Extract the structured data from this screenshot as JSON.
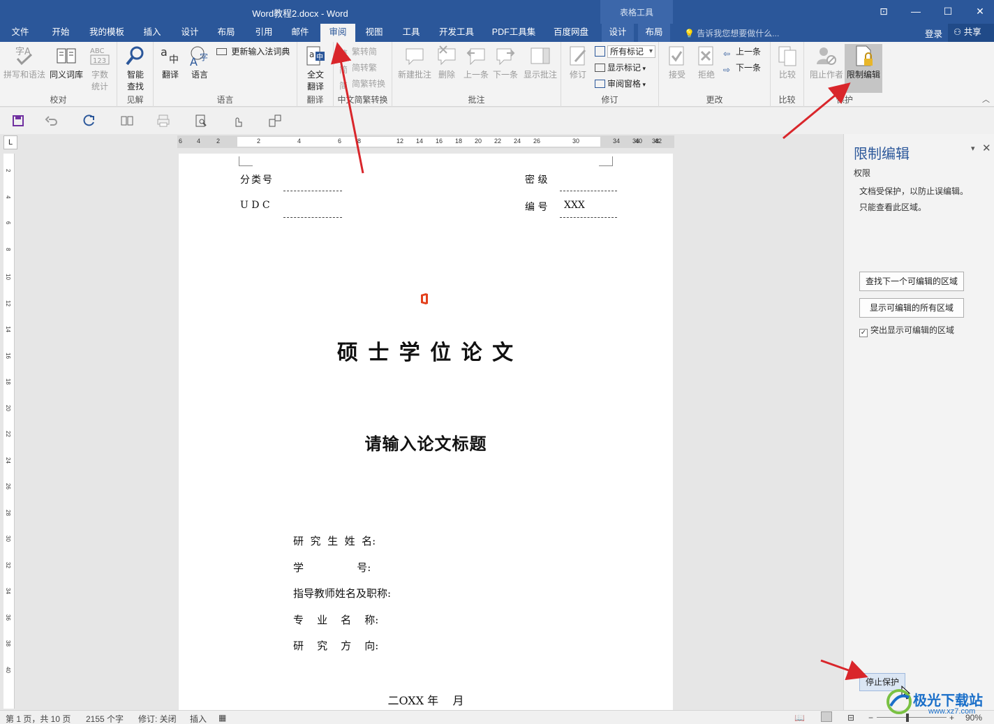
{
  "window": {
    "title": "Word教程2.docx - Word",
    "table_tools": "表格工具"
  },
  "tabs": [
    "文件",
    "开始",
    "我的模板",
    "插入",
    "设计",
    "布局",
    "引用",
    "邮件",
    "审阅",
    "视图",
    "工具",
    "开发工具",
    "PDF工具集",
    "百度网盘",
    "设计",
    "布局"
  ],
  "active_tab": "审阅",
  "tell_me": "告诉我您想要做什么...",
  "login": "登录",
  "share": "共享",
  "ribbon": {
    "proofing": {
      "label": "校对",
      "spelling": "拼写和语法",
      "thesaurus": "同义词库",
      "wordcount_line1": "字数",
      "wordcount_line2": "统计"
    },
    "insights": {
      "label": "见解",
      "smart_lookup_line1": "智能",
      "smart_lookup_line2": "查找"
    },
    "language": {
      "label": "语言",
      "translate": "翻译",
      "language": "语言",
      "update_ime": "更新输入法词典"
    },
    "translate": {
      "label": "翻译",
      "full_line1": "全文",
      "full_line2": "翻译"
    },
    "chinese": {
      "label": "中文简繁转换",
      "to_simplified": "繁转简",
      "to_traditional": "简转繁",
      "convert": "简繁转换"
    },
    "comments": {
      "label": "批注",
      "new": "新建批注",
      "delete": "删除",
      "prev": "上一条",
      "next": "下一条",
      "show": "显示批注"
    },
    "tracking": {
      "label": "修订",
      "track": "修订",
      "markup_select": "所有标记",
      "show_markup": "显示标记",
      "review_pane": "审阅窗格"
    },
    "changes": {
      "label": "更改",
      "accept": "接受",
      "reject": "拒绝",
      "prev": "上一条",
      "next": "下一条"
    },
    "compare": {
      "label": "比较",
      "compare": "比较"
    },
    "protect": {
      "label": "保护",
      "block_authors": "阻止作者",
      "restrict_editing": "限制编辑"
    }
  },
  "ruler": {
    "h_numbers": [
      "6",
      "4",
      "2",
      "2",
      "4",
      "6",
      "8",
      "12",
      "14",
      "16",
      "18",
      "20",
      "22",
      "24",
      "26",
      "30",
      "34",
      "36",
      "38",
      "40",
      "42"
    ],
    "v_numbers": [
      "2",
      "4",
      "6",
      "8",
      "10",
      "12",
      "14",
      "16",
      "18",
      "20",
      "22",
      "24",
      "26",
      "28",
      "30",
      "32",
      "34",
      "36",
      "38",
      "40"
    ],
    "corner": "L"
  },
  "document": {
    "class_no_label": "分类号",
    "secret_label": "密  级",
    "udc_label": "U D C",
    "number_label": "编  号",
    "number_value": "XXX",
    "thesis_type": "硕  士  学  位  论  文",
    "thesis_title": "请输入论文标题",
    "fields": [
      "研  究  生  姓  名:",
      "学                号:",
      "指导教师姓名及职称:",
      "专    业    名    称:",
      "研    究    方    向:"
    ],
    "date": "二OXX 年    月"
  },
  "pane": {
    "title": "限制编辑",
    "subtitle": "权限",
    "text_line1": "文档受保护，以防止误编辑。",
    "text_line2": "只能查看此区域。",
    "find_next": "查找下一个可编辑的区域",
    "show_all": "显示可编辑的所有区域",
    "highlight": "突出显示可编辑的区域",
    "highlight_checked": true,
    "stop_protection": "停止保护"
  },
  "status": {
    "page": "第 1 页，共 10 页",
    "words": "2155 个字",
    "track": "修订: 关闭",
    "insert": "插入",
    "zoom": "90%"
  },
  "watermark": {
    "text": "极光下载站",
    "url": "www.xz7.com"
  },
  "colors": {
    "accent": "#2b579a",
    "arrow": "#d9262b"
  }
}
